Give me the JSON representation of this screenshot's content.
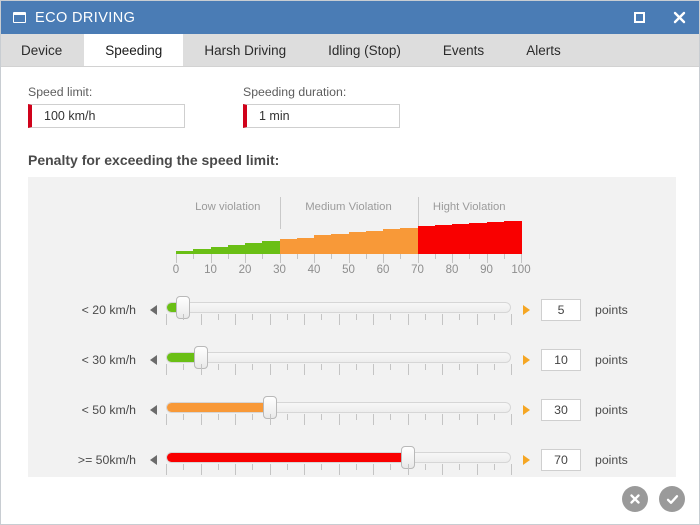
{
  "window": {
    "title": "ECO DRIVING",
    "icon": "window-icon",
    "controls": {
      "maximize": "maximize-icon",
      "close": "close-icon"
    },
    "titlebar_color": "#4a7cb5"
  },
  "tabs": [
    {
      "label": "Device",
      "active": false
    },
    {
      "label": "Speeding",
      "active": true
    },
    {
      "label": "Harsh Driving",
      "active": false
    },
    {
      "label": "Idling (Stop)",
      "active": false
    },
    {
      "label": "Events",
      "active": false
    },
    {
      "label": "Alerts",
      "active": false
    }
  ],
  "fields": [
    {
      "label": "Speed limit:",
      "value": "100 km/h",
      "placeholder": "100 km/h",
      "marker_color": "#d0021b"
    },
    {
      "label": "Speeding duration:",
      "value": "1 min",
      "placeholder": "1 min",
      "marker_color": "#d0021b"
    }
  ],
  "section": {
    "title": "Penalty for exceeding the speed limit:"
  },
  "chart_data": {
    "type": "bar",
    "title": "Penalty for exceeding the speed limit:",
    "xlabel": "",
    "ylabel": "",
    "xlim": [
      0,
      100
    ],
    "grid": false,
    "tick_labels": [
      "0",
      "10",
      "20",
      "30",
      "40",
      "50",
      "60",
      "70",
      "80",
      "90",
      "100"
    ],
    "tick_values": [
      0,
      10,
      20,
      30,
      40,
      50,
      60,
      70,
      80,
      90,
      100
    ],
    "minor_tick_values": [
      5,
      15,
      25,
      35,
      45,
      55,
      65,
      75,
      85,
      95
    ],
    "zones": [
      {
        "name": "Low violation",
        "from": 0,
        "to": 30,
        "color": "#6abf15",
        "label_at": 15
      },
      {
        "name": "Medium Violation",
        "from": 30,
        "to": 70,
        "color": "#f89938",
        "label_at": 50
      },
      {
        "name": "Hight Violation",
        "from": 70,
        "to": 100,
        "color": "#f90000",
        "label_at": 85
      }
    ],
    "zone_dividers": [
      30,
      70
    ],
    "categories": [
      2.5,
      7.5,
      12.5,
      17.5,
      22.5,
      27.5,
      32.5,
      37.5,
      42.5,
      47.5,
      52.5,
      57.5,
      62.5,
      67.5,
      72.5,
      77.5,
      82.5,
      87.5,
      92.5,
      97.5
    ],
    "values": [
      3,
      5,
      7,
      9,
      11,
      13,
      15,
      16,
      18,
      19,
      21,
      22,
      24,
      25,
      27,
      28,
      29,
      30,
      31,
      32
    ]
  },
  "sliders": [
    {
      "label": "< 20 km/h",
      "value": 5,
      "points": "5",
      "min": 0,
      "max": 100,
      "color": "#6abf15"
    },
    {
      "label": "< 30 km/h",
      "value": 10,
      "points": "10",
      "min": 0,
      "max": 100,
      "color": "#6abf15"
    },
    {
      "label": "< 50 km/h",
      "value": 30,
      "points": "30",
      "min": 0,
      "max": 100,
      "color": "#f89938"
    },
    {
      "label": ">= 50km/h",
      "value": 70,
      "points": "70",
      "min": 0,
      "max": 100,
      "color": "#f90000"
    }
  ],
  "slider_controls": {
    "decrement": "left-arrow-icon",
    "increment": "right-arrow-icon",
    "points_label": "points"
  },
  "footer": {
    "cancel": "cancel-icon",
    "confirm": "confirm-icon",
    "button_color": "#9a9a9a"
  }
}
